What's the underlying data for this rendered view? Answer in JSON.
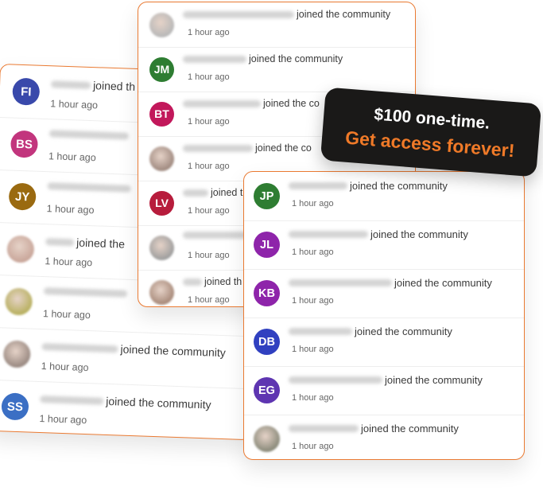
{
  "colors": {
    "accent": "#ea7a32",
    "cta": "#f07a28",
    "badge_bg": "#1a1918"
  },
  "cards": [
    {
      "id": "left",
      "items": [
        {
          "initials": "FI",
          "avatar_color": "#3949ab",
          "photo": false,
          "name_width": 50,
          "action": "joined th",
          "time": "1 hour ago"
        },
        {
          "initials": "BS",
          "avatar_color": "#c2357d",
          "photo": false,
          "name_width": 100,
          "action": "",
          "time": "1 hour ago"
        },
        {
          "initials": "JY",
          "avatar_color": "#9a6a10",
          "photo": false,
          "name_width": 105,
          "action": "",
          "time": "1 hour ago"
        },
        {
          "initials": "",
          "avatar_color": "#c9a69a",
          "photo": true,
          "name_width": 36,
          "action": "joined the",
          "time": "1 hour ago"
        },
        {
          "initials": "",
          "avatar_color": "#b8b060",
          "photo": true,
          "name_width": 105,
          "action": "",
          "time": "1 hour ago"
        },
        {
          "initials": "",
          "avatar_color": "#9a8a82",
          "photo": true,
          "name_width": 96,
          "action": "joined the community",
          "time": "1 hour ago"
        },
        {
          "initials": "SS",
          "avatar_color": "#3b6fc4",
          "photo": false,
          "name_width": 80,
          "action": "joined the community",
          "time": "1 hour ago"
        }
      ]
    },
    {
      "id": "middle",
      "items": [
        {
          "initials": "",
          "avatar_color": "#b8b8b8",
          "photo": true,
          "name_width": 140,
          "action": "joined the community",
          "time": "1 hour ago"
        },
        {
          "initials": "JM",
          "avatar_color": "#2e7d32",
          "photo": false,
          "name_width": 80,
          "action": "joined the community",
          "time": "1 hour ago"
        },
        {
          "initials": "BT",
          "avatar_color": "#c2185b",
          "photo": false,
          "name_width": 98,
          "action": "joined the co",
          "time": "1 hour ago"
        },
        {
          "initials": "",
          "avatar_color": "#a08a80",
          "photo": true,
          "name_width": 88,
          "action": "joined the co",
          "time": "1 hour ago"
        },
        {
          "initials": "LV",
          "avatar_color": "#b71c3c",
          "photo": false,
          "name_width": 32,
          "action": "joined t",
          "time": "1 hour ago"
        },
        {
          "initials": "",
          "avatar_color": "#9e9e9e",
          "photo": true,
          "name_width": 80,
          "action": "",
          "time": "1 hour ago"
        },
        {
          "initials": "",
          "avatar_color": "#a88a7a",
          "photo": true,
          "name_width": 24,
          "action": "joined th",
          "time": "1 hour ago"
        }
      ]
    },
    {
      "id": "right",
      "items": [
        {
          "initials": "JP",
          "avatar_color": "#2e7d32",
          "photo": false,
          "name_width": 74,
          "action": "joined the community",
          "time": "1 hour ago"
        },
        {
          "initials": "JL",
          "avatar_color": "#8e24aa",
          "photo": false,
          "name_width": 100,
          "action": "joined the community",
          "time": "1 hour ago"
        },
        {
          "initials": "KB",
          "avatar_color": "#8e24aa",
          "photo": false,
          "name_width": 130,
          "action": "joined the community",
          "time": "1 hour ago"
        },
        {
          "initials": "DB",
          "avatar_color": "#3040c0",
          "photo": false,
          "name_width": 80,
          "action": "joined the community",
          "time": "1 hour ago"
        },
        {
          "initials": "EG",
          "avatar_color": "#5e35b1",
          "photo": false,
          "name_width": 118,
          "action": "joined the community",
          "time": "1 hour ago"
        },
        {
          "initials": "",
          "avatar_color": "#8a8a7a",
          "photo": true,
          "name_width": 88,
          "action": "joined the community",
          "time": "1 hour ago"
        }
      ]
    }
  ],
  "promo": {
    "line1": "$100 one-time.",
    "line2": "Get access forever!"
  }
}
